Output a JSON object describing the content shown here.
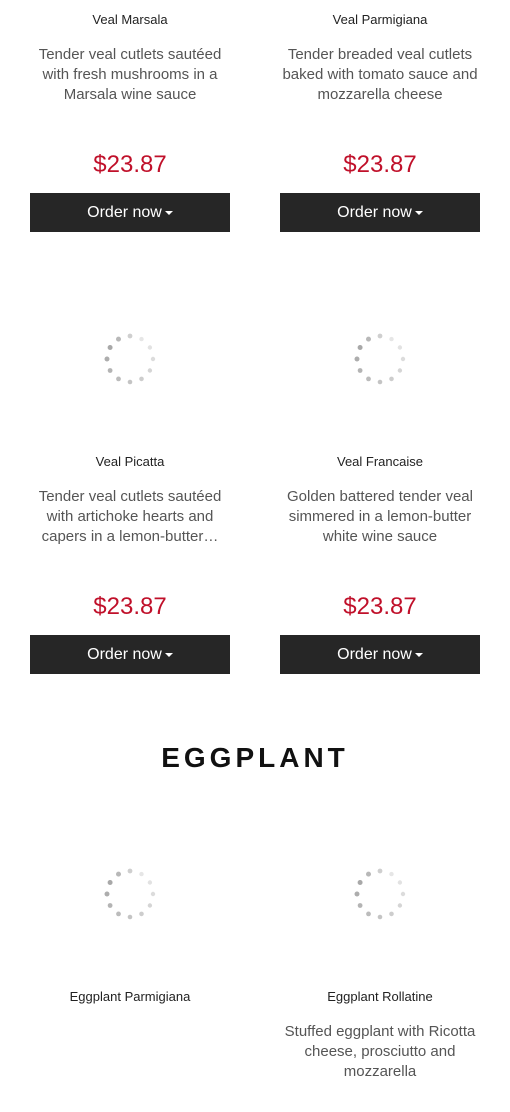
{
  "items": [
    {
      "name": "Veal Marsala",
      "description": "Tender veal cutlets sautéed with fresh mushrooms in a Marsala wine sauce",
      "price": "$23.87",
      "order_label": "Order now"
    },
    {
      "name": "Veal Parmigiana",
      "description": "Tender breaded veal cutlets baked with tomato sauce and mozzarella cheese",
      "price": "$23.87",
      "order_label": "Order now"
    },
    {
      "name": "Veal Picatta",
      "description": "Tender veal cutlets sautéed with artichoke hearts and capers in a lemon-butter…",
      "price": "$23.87",
      "order_label": "Order now"
    },
    {
      "name": "Veal Francaise",
      "description": "Golden battered tender veal simmered in a lemon-butter white wine sauce",
      "price": "$23.87",
      "order_label": "Order now"
    }
  ],
  "section": {
    "title": "EGGPLANT"
  },
  "eggplant_items": [
    {
      "name": "Eggplant Parmigiana",
      "description": ""
    },
    {
      "name": "Eggplant Rollatine",
      "description": "Stuffed eggplant with Ricotta cheese, prosciutto and mozzarella"
    }
  ],
  "icons": {
    "loading": "loading-spinner-icon",
    "caret": "caret-down-icon"
  },
  "colors": {
    "price": "#c0102a",
    "button_bg": "#262626",
    "button_text": "#ffffff"
  }
}
